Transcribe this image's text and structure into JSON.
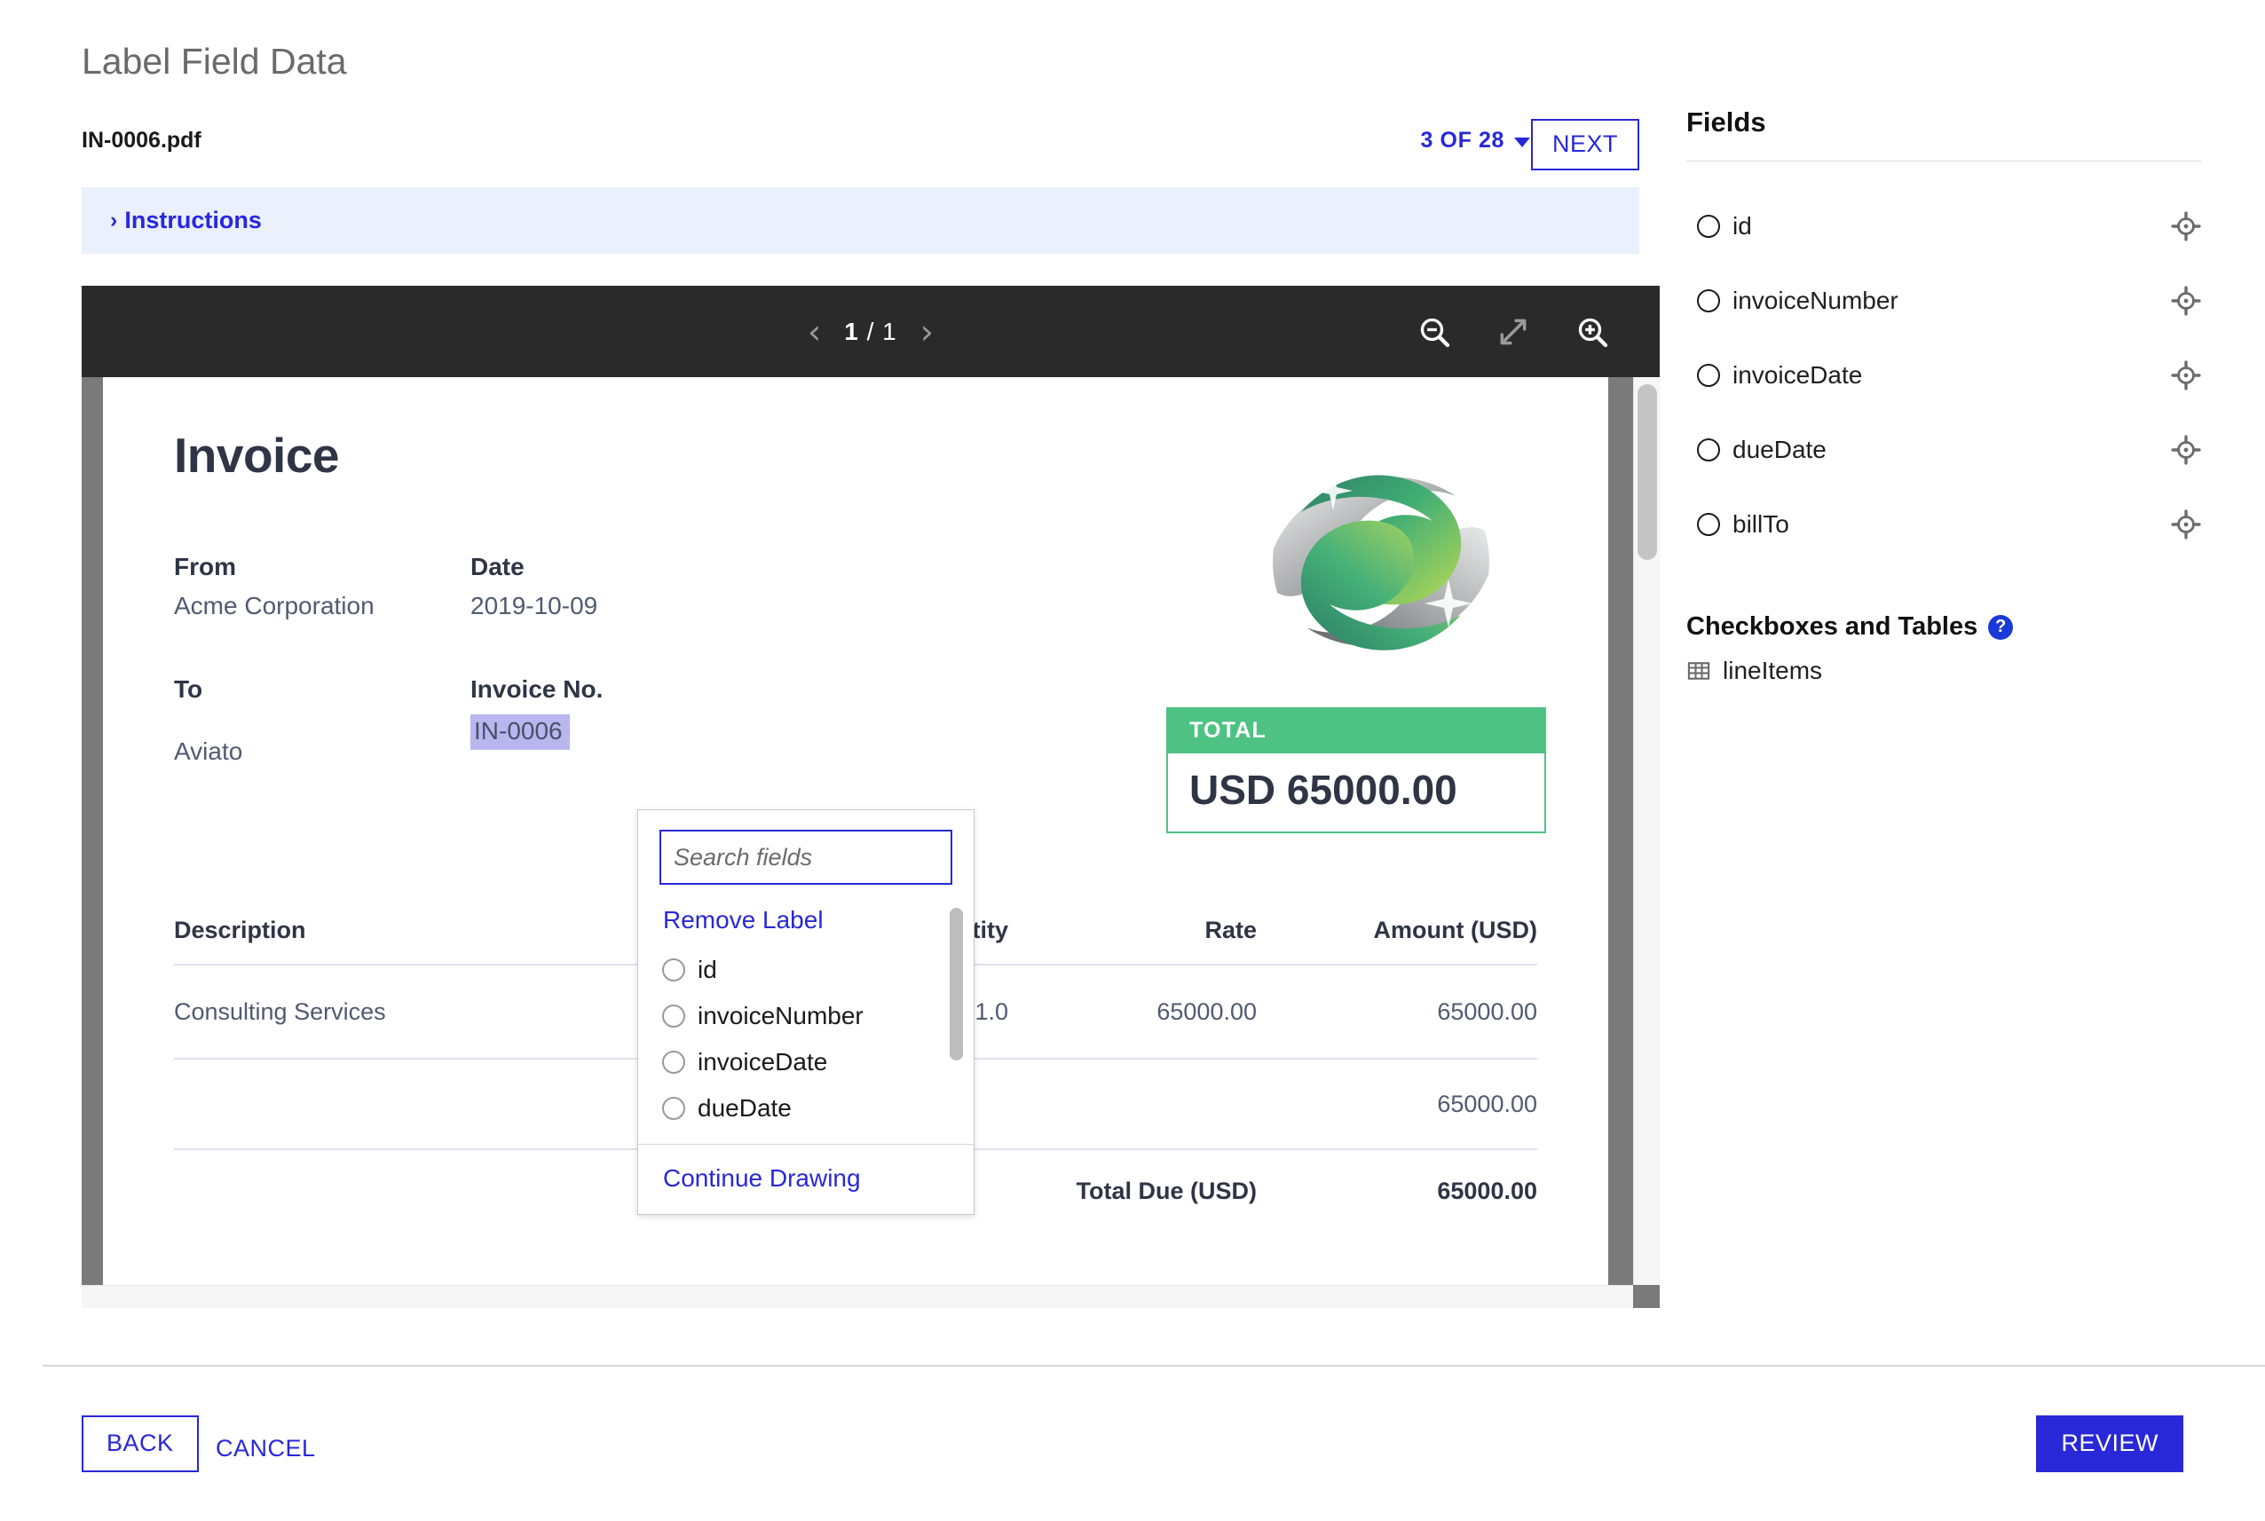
{
  "header": {
    "page_title": "Label Field Data",
    "document_name": "IN-0006.pdf",
    "pager_label": "3 OF 28",
    "next_label": "NEXT",
    "instructions_label": "Instructions",
    "instructions_chevron": "›"
  },
  "viewer": {
    "prev_arrow": "‹",
    "next_arrow": "›",
    "current_page": "1",
    "page_separator": "/",
    "total_pages": "1",
    "zoom_out_icon": "zoom-out-icon",
    "fit_icon": "fit-screen-icon",
    "zoom_in_icon": "zoom-in-icon"
  },
  "invoice": {
    "title": "Invoice",
    "from_label": "From",
    "from_value": "Acme Corporation",
    "to_label": "To",
    "to_value": "Aviato",
    "date_label": "Date",
    "date_value": "2019-10-09",
    "invoice_no_label": "Invoice No.",
    "invoice_no_value": "IN-0006",
    "total_card_label": "TOTAL",
    "total_card_value": "USD 65000.00",
    "columns": {
      "description": "Description",
      "quantity": "Quantity",
      "rate": "Rate",
      "amount": "Amount (USD)"
    },
    "rows": [
      {
        "description": "Consulting Services",
        "quantity": "1.0",
        "rate": "65000.00",
        "amount": "65000.00"
      }
    ],
    "subtotal_amount": "65000.00",
    "total_due_label": "Total Due (USD)",
    "total_due_amount": "65000.00",
    "highlight_color": "#b9b6ef",
    "accent_green": "#4ec283"
  },
  "popup": {
    "search_placeholder": "Search fields",
    "search_value": "",
    "remove_label": "Remove Label",
    "options": [
      {
        "label": "id"
      },
      {
        "label": "invoiceNumber"
      },
      {
        "label": "invoiceDate"
      },
      {
        "label": "dueDate"
      }
    ],
    "continue_label": "Continue Drawing"
  },
  "sidebar": {
    "title": "Fields",
    "fields": [
      {
        "label": "id"
      },
      {
        "label": "invoiceNumber"
      },
      {
        "label": "invoiceDate"
      },
      {
        "label": "dueDate"
      },
      {
        "label": "billTo"
      }
    ],
    "section_title": "Checkboxes and Tables",
    "help_glyph": "?",
    "tables": [
      {
        "label": "lineItems"
      }
    ]
  },
  "footer": {
    "back_label": "BACK",
    "cancel_label": "CANCEL",
    "review_label": "REVIEW"
  },
  "colors": {
    "accent_blue": "#2828d8",
    "banner_bg": "#eaf1fc",
    "toolbar_bg": "#2a2a2a",
    "viewer_bg": "#7a7a7a"
  }
}
